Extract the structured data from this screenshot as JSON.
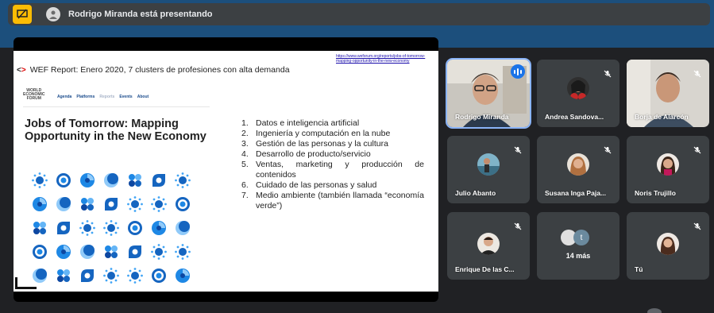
{
  "presentation_bar": {
    "presenting_text": "Rodrigo Miranda está presentando",
    "icon": "present-screen-icon"
  },
  "slide": {
    "title": "WEF Report: Enero 2020, 7 clusters de profesiones con alta demanda",
    "link": "https://www.weforum.org/reports/jobs-of-tomorrow-mapping-opportunity-in-the-new-economy",
    "logo_lines": [
      "WORLD",
      "ECONOMIC",
      "FORUM"
    ],
    "nav": [
      "Agenda",
      "Platforms",
      "Reports",
      "Events",
      "About"
    ],
    "heading": "Jobs of Tomorrow: Mapping Opportunity in the New Economy",
    "list": [
      {
        "n": "1.",
        "text": "Datos e inteligencia artificial"
      },
      {
        "n": "2.",
        "text": "Ingeniería y computación en la nube"
      },
      {
        "n": "3.",
        "text": "Gestión de las personas y la cultura"
      },
      {
        "n": "4.",
        "text": "Desarrollo de producto/servicio"
      },
      {
        "n": "5.",
        "text": "Ventas, marketing y producción de contenidos"
      },
      {
        "n": "6.",
        "text": "Cuidado de las personas y salud"
      },
      {
        "n": "7.",
        "text": "Medio ambiente (también llamada “economía verde”)"
      }
    ]
  },
  "participants": [
    {
      "name": "Rodrigo Miranda",
      "muted": false,
      "speaking": true
    },
    {
      "name": "Andrea Sandova...",
      "muted": true
    },
    {
      "name": "Borja de Alarcón",
      "muted": true
    },
    {
      "name": "Julio Abanto",
      "muted": true
    },
    {
      "name": "Susana Inga Paja...",
      "muted": true
    },
    {
      "name": "Noris Trujillo",
      "muted": true
    },
    {
      "name": "Enrique De las C...",
      "muted": true
    },
    {
      "name": "14 más",
      "avatar_letter": "t"
    },
    {
      "name": "Tú",
      "muted": true
    }
  ],
  "colors": {
    "background": "#202124",
    "tile": "#3c4043",
    "accent": "#1a73e8",
    "present_icon": "#fbbc04",
    "header": "#1c4f7c"
  }
}
